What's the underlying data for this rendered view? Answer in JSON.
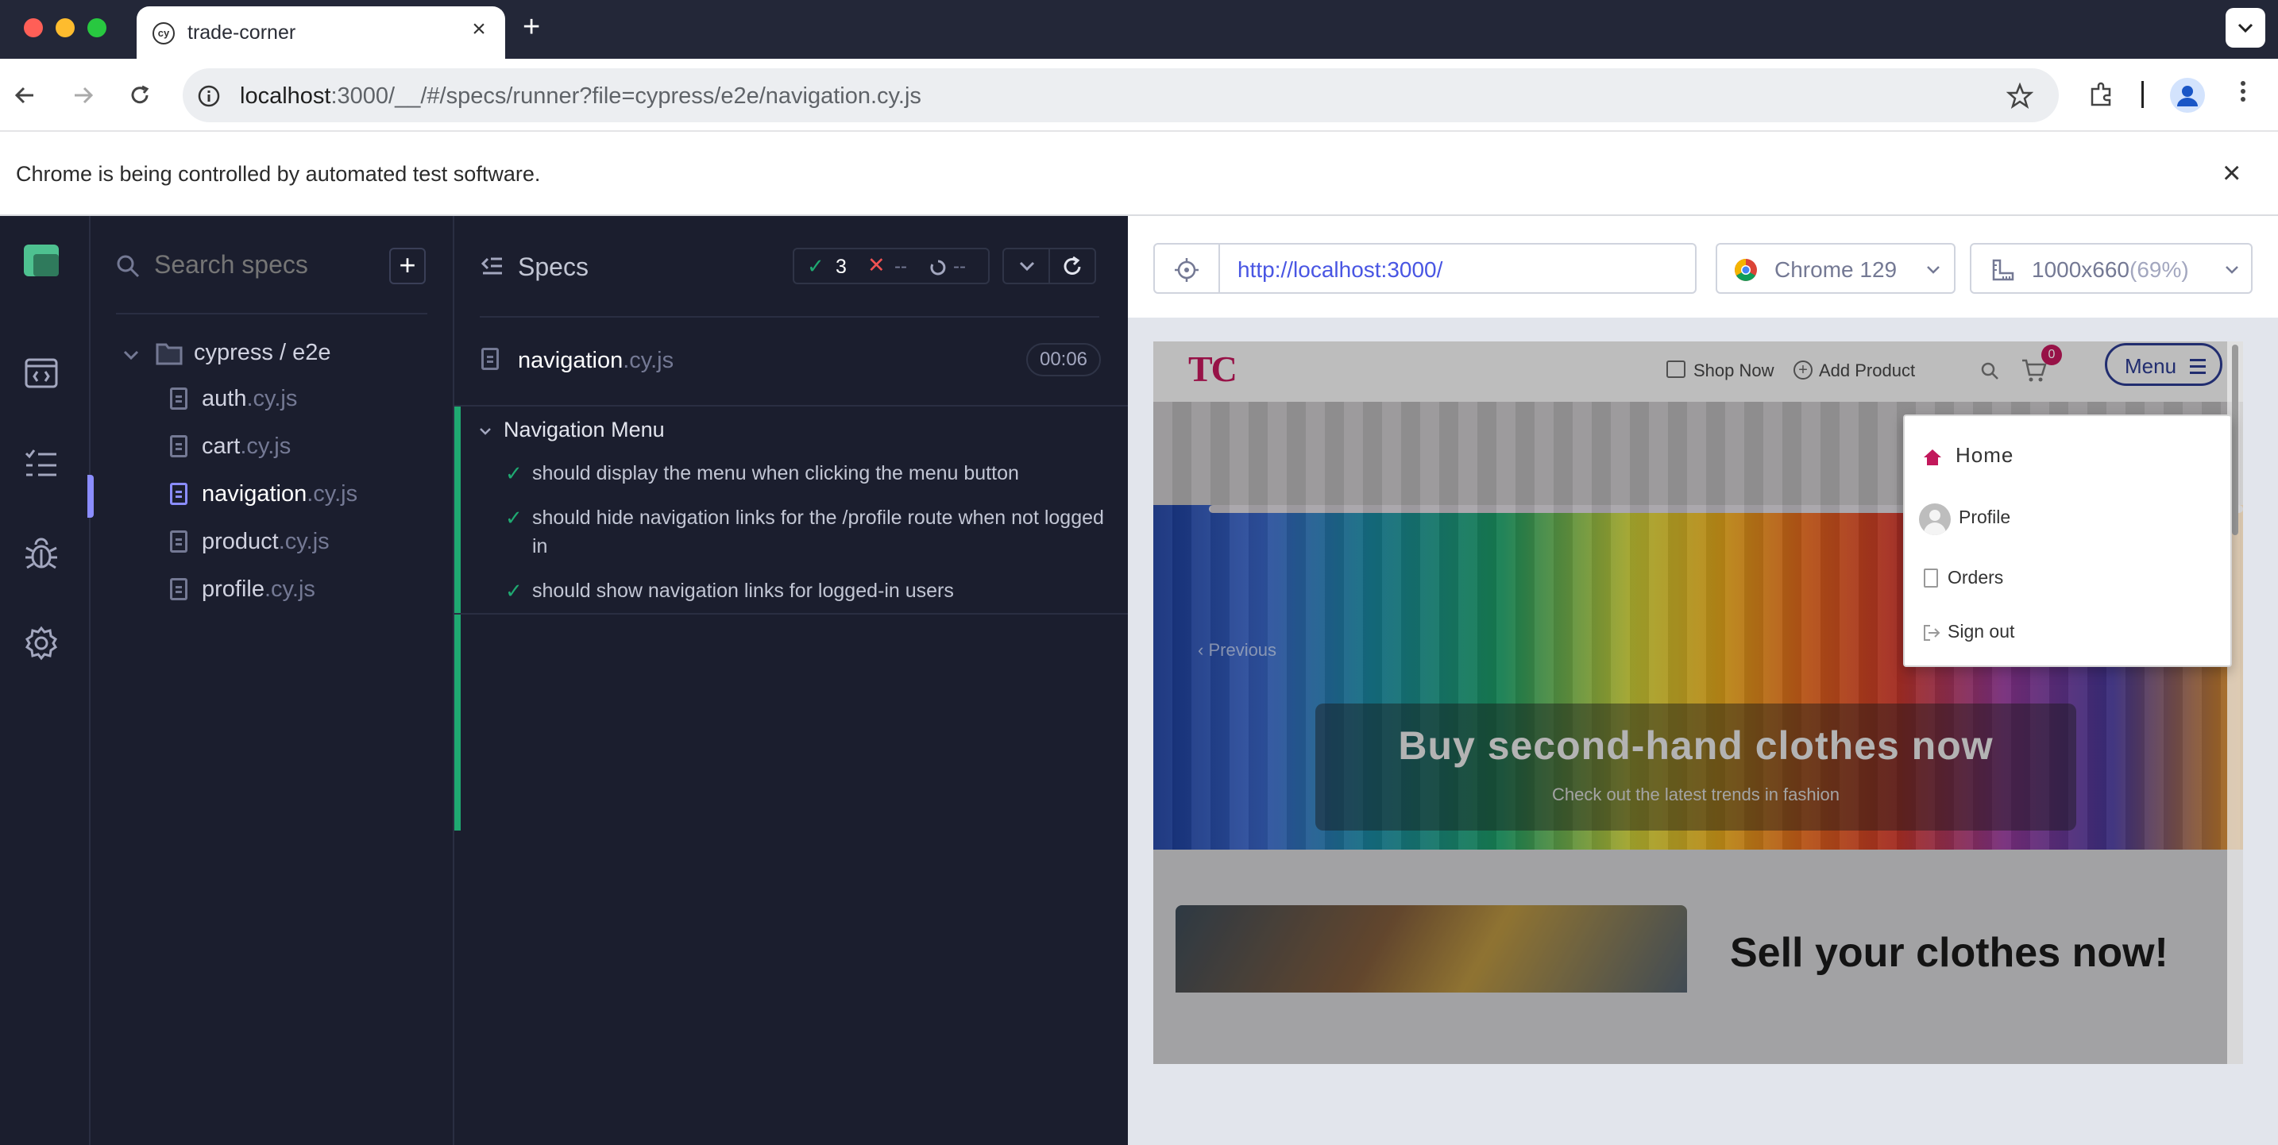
{
  "browser": {
    "tab_title": "trade-corner",
    "url_host": "localhost",
    "url_rest": ":3000/__/#/specs/runner?file=cypress/e2e/navigation.cy.js",
    "infobar_text": "Chrome is being controlled by automated test software."
  },
  "specs": {
    "search_placeholder": "Search specs",
    "folder": "cypress / e2e",
    "files": [
      {
        "name": "auth",
        "ext": ".cy.js"
      },
      {
        "name": "cart",
        "ext": ".cy.js"
      },
      {
        "name": "navigation",
        "ext": ".cy.js"
      },
      {
        "name": "product",
        "ext": ".cy.js"
      },
      {
        "name": "profile",
        "ext": ".cy.js"
      }
    ]
  },
  "reporter": {
    "title": "Specs",
    "passed": "3",
    "failed": "--",
    "pending": "--",
    "spec_name": "navigation",
    "spec_ext": ".cy.js",
    "duration": "00:06",
    "suite": "Navigation Menu",
    "tests": [
      "should display the menu when clicking the menu button",
      "should hide navigation links for the /profile route when not logged in",
      "should show navigation links for logged-in users"
    ]
  },
  "aut_bar": {
    "url": "http://localhost:3000/",
    "browser": "Chrome 129",
    "viewport": "1000x660",
    "scale": "(69%)"
  },
  "app": {
    "logo": "TC",
    "shop_now": "Shop Now",
    "add_product": "Add Product",
    "cart_count": "0",
    "menu_label": "Menu",
    "menu_items": [
      "Home",
      "Profile",
      "Orders",
      "Sign out"
    ],
    "carousel_prev": "Previous",
    "hero_title": "Buy second-hand clothes now",
    "hero_subtitle": "Check out the latest trends in fashion",
    "sell_title": "Sell your clothes now!"
  },
  "colors": {
    "cypress_green": "#1fa971",
    "cypress_indigo": "#8b8dff",
    "fail_red": "#f05252",
    "brand_pink": "#c2185b"
  }
}
